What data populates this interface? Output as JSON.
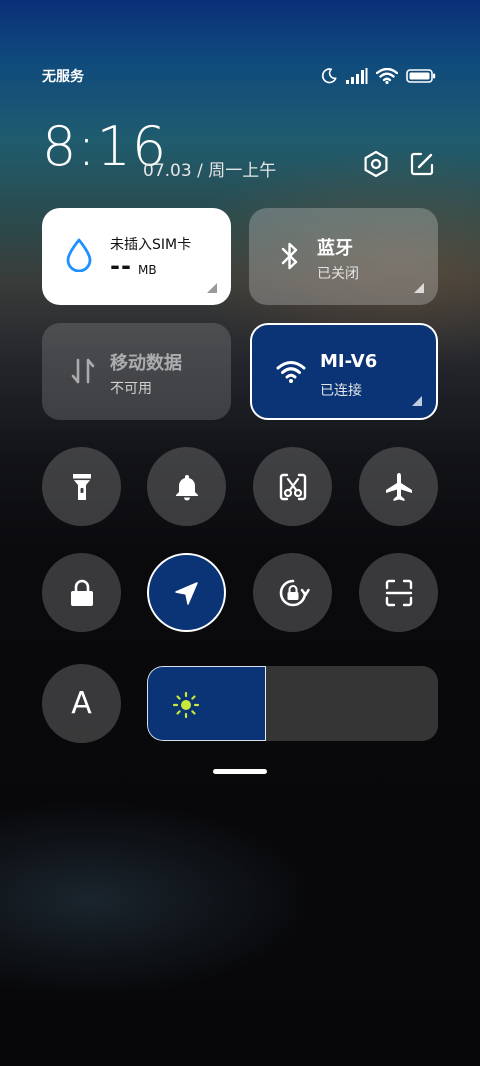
{
  "status_bar": {
    "carrier": "无服务",
    "icons": [
      "moon-icon",
      "signal-icon",
      "wifi-icon",
      "battery-icon"
    ]
  },
  "header": {
    "time": "8:16",
    "date": "07.03 / 周一上午",
    "icons": [
      "settings-icon",
      "edit-icon"
    ]
  },
  "tiles": {
    "data_usage": {
      "title": "未插入SIM卡",
      "value": "--",
      "unit": "MB",
      "icon": "water-drop-icon"
    },
    "bluetooth": {
      "title": "蓝牙",
      "status": "已关闭",
      "icon": "bluetooth-icon"
    },
    "mobile_data": {
      "title": "移动数据",
      "status": "不可用",
      "icon": "data-arrows-icon"
    },
    "wifi": {
      "title": "MI-V6",
      "status": "已连接",
      "icon": "wifi-icon"
    }
  },
  "toggles_row1": [
    "flashlight-icon",
    "bell-icon",
    "screenshot-icon",
    "airplane-icon"
  ],
  "toggles_row2": [
    "lock-icon",
    "location-icon",
    "rotation-lock-icon",
    "scan-icon"
  ],
  "toggles_row3": [
    "font-size-icon"
  ],
  "font_toggle_label": "A",
  "brightness": {
    "level": 0.41,
    "icon": "sun-icon"
  },
  "colors": {
    "accent_blue": "#0b3476",
    "drop_blue": "#1e90ff",
    "sun_yellow": "#c8e83a"
  }
}
